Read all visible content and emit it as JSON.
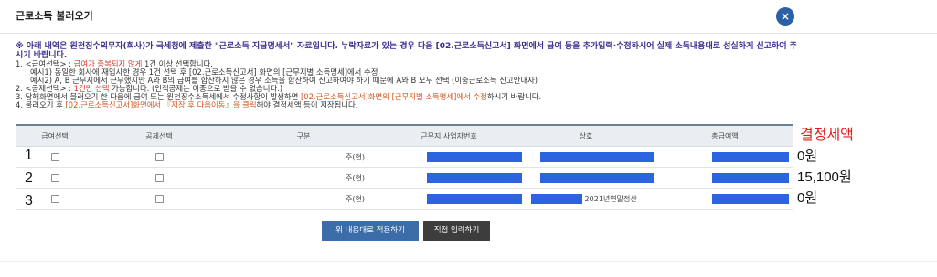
{
  "dialog": {
    "title": "근로소득 불러오기",
    "close_label": "×"
  },
  "notice": {
    "headline": "※ 아래 내역은 원천징수의무자(회사)가 국세청에 제출한 \"근로소득 지급명세서\" 자료입니다. 누락자료가 있는 경우 다음 [02.근로소득신고서] 화면에서 급여 등을 추가입력·수정하시어 실제 소득내용대로 성실하게 신고하여 주시기 바랍니다.",
    "item1_label": "1. <급여선택> : ",
    "item1_red": "급여가 중복되지 않게",
    "item1_rest": " 1건 이상 선택합니다.",
    "item1_ex1": "예시1) 동일한 회사에 재입사한 경우 1건 선택 후 [02.근로소득신고서] 화면의 [근무지별 소득명세]에서 수정",
    "item1_ex2": "예시2) A, B 근무지에서 근무했지만 A와 B의 급여를 합산하지 않은 경우 소득을 합산하여 신고하여야 하기 때문에 A와 B 모두 선택 (이중근로소득 신고안내자)",
    "item2_label": "2. <공제선택> : ",
    "item2_red": "1건만 선택",
    "item2_rest": " 가능합니다. (인적공제는 이중으로 받을 수 없습니다.)",
    "item3_a": "3. 당해화면에서 불러오기 한 다음에 급여 또는 원천징수소득세에서 수정사항이 발생하면 ",
    "item3_red": "[02.근로소득신고서]화면의 [근무지별 소득명세]에서 수정",
    "item3_b": "하시기 바랍니다.",
    "item4_a": "4. 불러오기 후 ",
    "item4_red": "[02.근로소득신고서]화면에서 『저장 후 다음이동』을 클릭",
    "item4_b": "해야 결정세액 등이 저장됩니다."
  },
  "table": {
    "headers": [
      "급여선택",
      "공제선택",
      "구분",
      "근무지 사업자번호",
      "상호",
      "총급여액"
    ],
    "rows": [
      {
        "kind": "주(현)",
        "company_suffix": ""
      },
      {
        "kind": "주(현)",
        "company_suffix": ""
      },
      {
        "kind": "주(현)",
        "company_suffix": "2021년연말정산"
      }
    ]
  },
  "annotations": {
    "column_title": "결정세액",
    "row_numbers": [
      "1",
      "2",
      "3"
    ],
    "tax_values": [
      "0원",
      "15,100원",
      "0원"
    ]
  },
  "buttons": {
    "apply": "위 내용대로 적용하기",
    "direct_input": "직접 입력하기"
  },
  "colors": {
    "accent": "#3c6da8",
    "warning_red": "#d9372e",
    "annotation_red": "#e31b1b",
    "redaction_blue": "#2c63e0"
  }
}
